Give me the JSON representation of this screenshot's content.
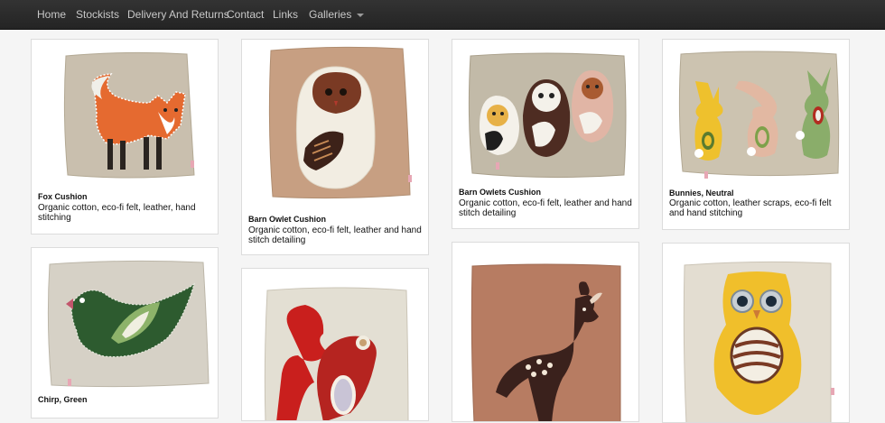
{
  "nav": {
    "items": [
      "Home",
      "Stockists",
      "Delivery And Returns",
      "Contact",
      "Links",
      "Galleries"
    ]
  },
  "products": [
    {
      "title": "Fox Cushion",
      "description": "Organic cotton, eco-fi felt, leather, hand stitching",
      "image": "fox-cushion-photo"
    },
    {
      "title": "Barn Owlet Cushion",
      "description": "Organic cotton, eco-fi felt, leather and hand stitch detailing",
      "image": "barn-owlet-cushion-photo"
    },
    {
      "title": "Barn Owlets Cushion",
      "description": "Organic cotton, eco-fi felt, leather and hand stitch detailing",
      "image": "barn-owlets-cushion-photo"
    },
    {
      "title": "Bunnies, Neutral",
      "description": "Organic cotton, leather scraps, eco-fi felt and hand stitching",
      "image": "bunnies-cushion-photo"
    },
    {
      "title": "Chirp, Green",
      "description": "",
      "image": "bird-cushion-photo"
    },
    {
      "title": "",
      "description": "",
      "image": "squirrel-cushion-photo"
    },
    {
      "title": "",
      "description": "",
      "image": "deer-cushion-photo"
    },
    {
      "title": "",
      "description": "",
      "image": "yellow-owl-cushion-photo"
    }
  ]
}
